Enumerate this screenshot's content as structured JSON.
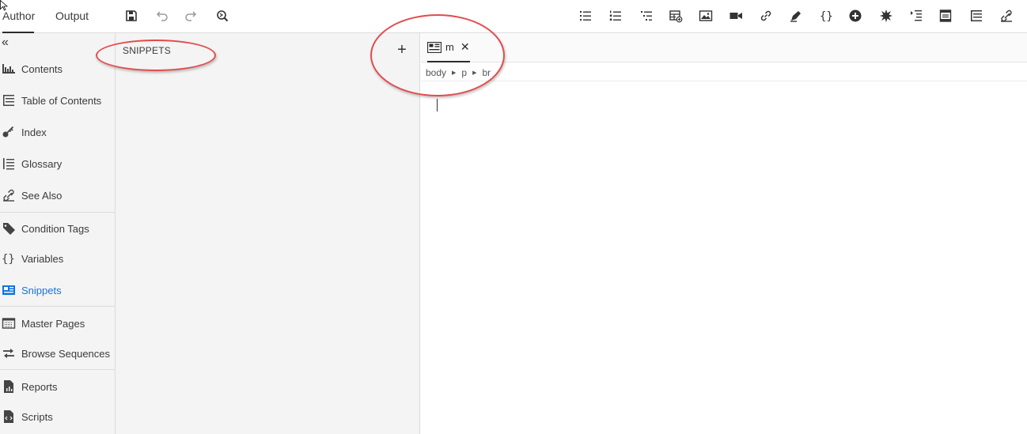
{
  "header": {
    "tabs": [
      {
        "label": "Author",
        "active": true
      },
      {
        "label": "Output",
        "active": false
      }
    ],
    "toolbar_left": [
      {
        "name": "save",
        "icon": "save-icon"
      },
      {
        "name": "undo",
        "icon": "undo-icon"
      },
      {
        "name": "redo",
        "icon": "redo-icon"
      },
      {
        "name": "find-replace",
        "icon": "find-icon"
      }
    ],
    "toolbar_right": [
      {
        "name": "bulleted-list",
        "icon": "bullet-list-icon"
      },
      {
        "name": "numbered-list",
        "icon": "numbered-list-icon"
      },
      {
        "name": "multilevel-list",
        "icon": "multilevel-list-icon"
      },
      {
        "name": "insert-table",
        "icon": "table-insert-icon"
      },
      {
        "name": "insert-image",
        "icon": "image-icon"
      },
      {
        "name": "insert-video",
        "icon": "video-icon"
      },
      {
        "name": "insert-link",
        "icon": "link-icon"
      },
      {
        "name": "insert-bookmark",
        "icon": "bookmark-icon"
      },
      {
        "name": "insert-variable",
        "icon": "braces-icon"
      },
      {
        "name": "insert-snippet",
        "icon": "plus-circle-icon"
      },
      {
        "name": "insert-symbol",
        "icon": "star-burst-icon"
      },
      {
        "name": "insert-toc",
        "icon": "toc-insert-icon"
      },
      {
        "name": "insert-master-page",
        "icon": "page-layout-icon"
      },
      {
        "name": "table-of-contents",
        "icon": "toc-icon"
      },
      {
        "name": "see-also",
        "icon": "see-also-icon"
      }
    ]
  },
  "leftnav": {
    "collapse_label": "«",
    "items": [
      {
        "label": "Contents",
        "icon": "contents-icon",
        "active": false
      },
      {
        "label": "Table of Contents",
        "icon": "toc-icon",
        "active": false
      },
      {
        "label": "Index",
        "icon": "key-icon",
        "active": false
      },
      {
        "label": "Glossary",
        "icon": "glossary-icon",
        "active": false
      },
      {
        "label": "See Also",
        "icon": "see-also-icon",
        "active": false
      },
      {
        "label": "Condition Tags",
        "icon": "tag-icon",
        "active": false
      },
      {
        "label": "Variables",
        "icon": "braces-icon",
        "active": false
      },
      {
        "label": "Snippets",
        "icon": "snippet-icon",
        "active": true
      },
      {
        "label": "Master Pages",
        "icon": "master-page-icon",
        "active": false
      },
      {
        "label": "Browse Sequences",
        "icon": "browse-sequence-icon",
        "active": false
      },
      {
        "label": "Reports",
        "icon": "report-icon",
        "active": false
      },
      {
        "label": "Scripts",
        "icon": "script-icon",
        "active": false
      }
    ]
  },
  "snippets_panel": {
    "title": "SNIPPETS",
    "add_label": "+"
  },
  "editor": {
    "tab": {
      "label": "m",
      "close_label": "✕",
      "icon": "snippet-icon"
    },
    "breadcrumb": [
      "body",
      "p",
      "br"
    ],
    "breadcrumb_separator": "▶"
  },
  "colors": {
    "accent": "#1473e6",
    "annotation": "#e24b4b",
    "panel_bg": "#f4f4f4"
  }
}
